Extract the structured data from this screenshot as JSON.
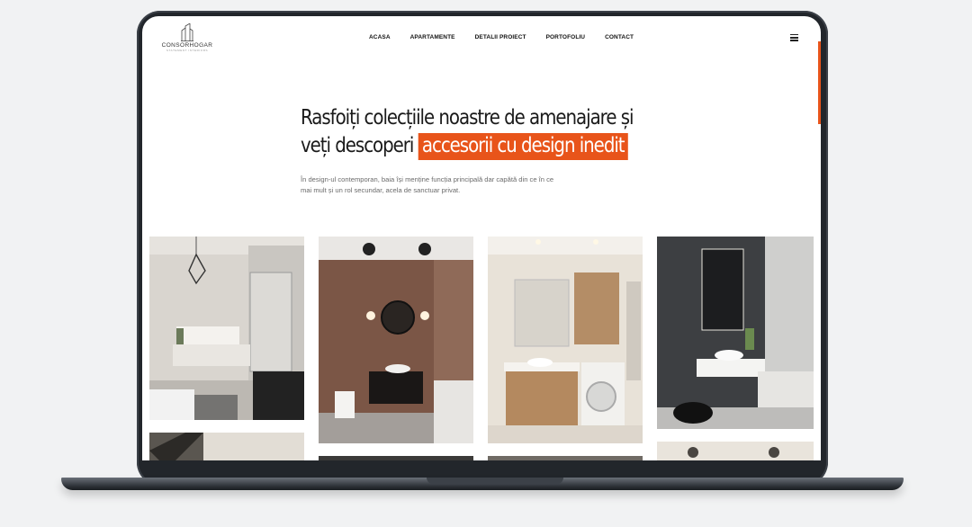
{
  "app": {
    "brand": "CONSORHOGAR",
    "tagline": "STATEMENT INTERIORS"
  },
  "nav": {
    "items": [
      "ACASA",
      "APARTAMENTE",
      "DETALII PROIECT",
      "PORTOFOLIU",
      "CONTACT"
    ]
  },
  "hero": {
    "line1": "Rasfoiți colecțiile noastre de amenajare și",
    "line2_prefix": "veți descoperi ",
    "line2_highlight": "accesorii cu design inedit",
    "intro_line1": "În design-ul contemporan, baia își menține funcția principală dar capătă din ce în ce",
    "intro_line2": "mai mult și un rol secundar, acela de sanctuar privat."
  },
  "colors": {
    "accent": "#e8541a",
    "text": "#1a1a1a",
    "muted": "#6b6b6b",
    "frame": "#22262b"
  },
  "icons": {
    "menu": "hamburger-menu-icon",
    "logo": "building-logo-icon"
  }
}
